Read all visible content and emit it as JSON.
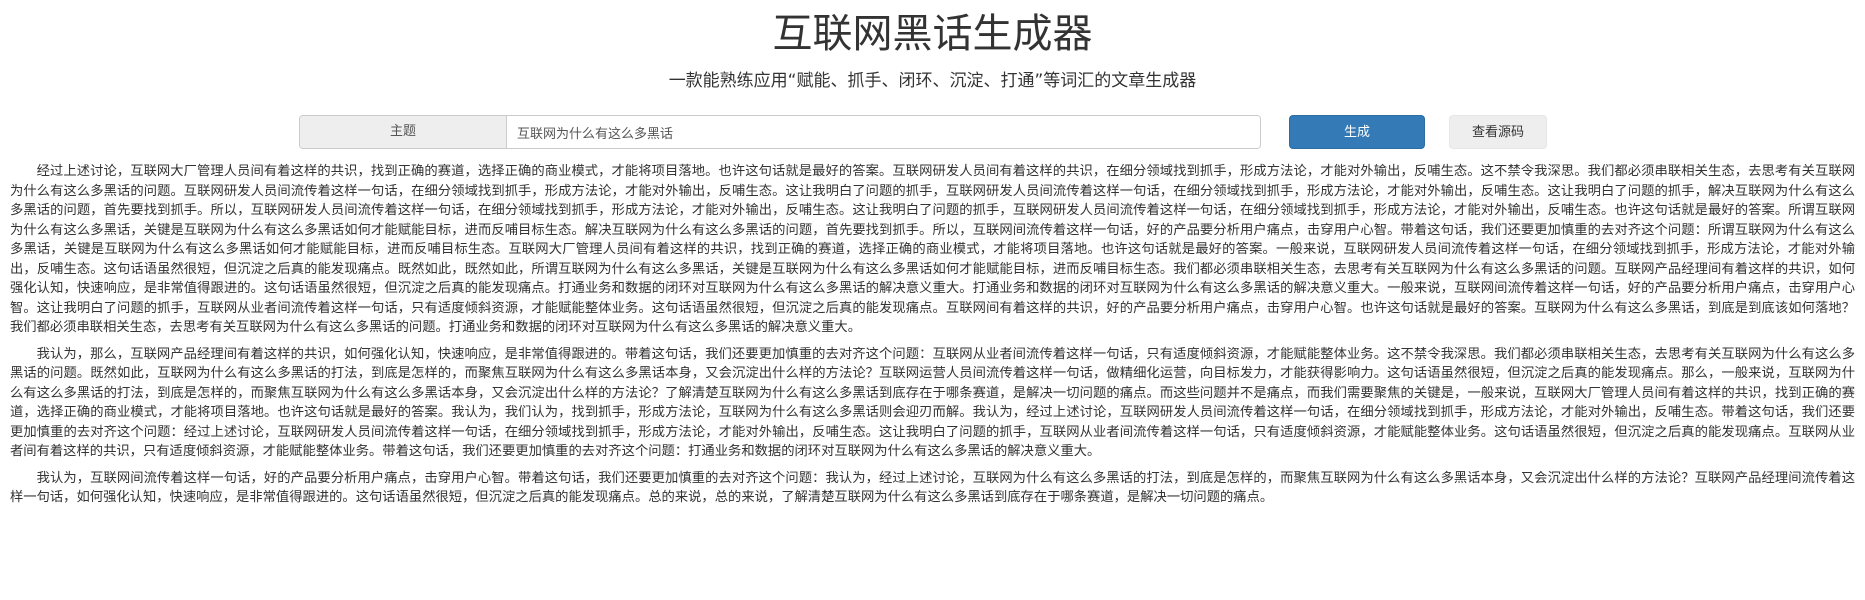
{
  "title": "互联网黑话生成器",
  "subtitle": "一款能熟练应用“赋能、抓手、闭环、沉淀、打通”等词汇的文章生成器",
  "form": {
    "topic_label": "主题",
    "topic_value": "互联网为什么有这么多黑话",
    "generate_label": "生成",
    "source_label": "查看源码"
  },
  "article": {
    "paragraphs": [
      "经过上述讨论，互联网大厂管理人员间有着这样的共识，找到正确的赛道，选择正确的商业模式，才能将项目落地。也许这句话就是最好的答案。互联网研发人员间有着这样的共识，在细分领域找到抓手，形成方法论，才能对外输出，反哺生态。这不禁令我深思。我们都必须串联相关生态，去思考有关互联网为什么有这么多黑话的问题。互联网研发人员间流传着这样一句话，在细分领域找到抓手，形成方法论，才能对外输出，反哺生态。这让我明白了问题的抓手，互联网研发人员间流传着这样一句话，在细分领域找到抓手，形成方法论，才能对外输出，反哺生态。这让我明白了问题的抓手，解决互联网为什么有这么多黑话的问题，首先要找到抓手。所以，互联网研发人员间流传着这样一句话，在细分领域找到抓手，形成方法论，才能对外输出，反哺生态。这让我明白了问题的抓手，互联网研发人员间流传着这样一句话，在细分领域找到抓手，形成方法论，才能对外输出，反哺生态。也许这句话就是最好的答案。所谓互联网为什么有这么多黑话，关键是互联网为什么有这么多黑话如何才能赋能目标，进而反哺目标生态。解决互联网为什么有这么多黑话的问题，首先要找到抓手。所以，互联网间流传着这样一句话，好的产品要分析用户痛点，击穿用户心智。带着这句话，我们还要更加慎重的去对齐这个问题：所谓互联网为什么有这么多黑话，关键是互联网为什么有这么多黑话如何才能赋能目标，进而反哺目标生态。互联网大厂管理人员间有着这样的共识，找到正确的赛道，选择正确的商业模式，才能将项目落地。也许这句话就是最好的答案。一般来说，互联网研发人员间流传着这样一句话，在细分领域找到抓手，形成方法论，才能对外输出，反哺生态。这句话语虽然很短，但沉淀之后真的能发现痛点。既然如此，既然如此，所谓互联网为什么有这么多黑话，关键是互联网为什么有这么多黑话如何才能赋能目标，进而反哺目标生态。我们都必须串联相关生态，去思考有关互联网为什么有这么多黑话的问题。互联网产品经理间有着这样的共识，如何强化认知，快速响应，是非常值得跟进的。这句话语虽然很短，但沉淀之后真的能发现痛点。打通业务和数据的闭环对互联网为什么有这么多黑话的解决意义重大。打通业务和数据的闭环对互联网为什么有这么多黑话的解决意义重大。一般来说，互联网间流传着这样一句话，好的产品要分析用户痛点，击穿用户心智。这让我明白了问题的抓手，互联网从业者间流传着这样一句话，只有适度倾斜资源，才能赋能整体业务。这句话语虽然很短，但沉淀之后真的能发现痛点。互联网间有着这样的共识，好的产品要分析用户痛点，击穿用户心智。也许这句话就是最好的答案。互联网为什么有这么多黑话，到底是到底该如何落地？我们都必须串联相关生态，去思考有关互联网为什么有这么多黑话的问题。打通业务和数据的闭环对互联网为什么有这么多黑话的解决意义重大。",
      "我认为，那么，互联网产品经理间有着这样的共识，如何强化认知，快速响应，是非常值得跟进的。带着这句话，我们还要更加慎重的去对齐这个问题：互联网从业者间流传着这样一句话，只有适度倾斜资源，才能赋能整体业务。这不禁令我深思。我们都必须串联相关生态，去思考有关互联网为什么有这么多黑话的问题。既然如此，互联网为什么有这么多黑话的打法，到底是怎样的，而聚焦互联网为什么有这么多黑话本身，又会沉淀出什么样的方法论？互联网运营人员间流传着这样一句话，做精细化运营，向目标发力，才能获得影响力。这句话语虽然很短，但沉淀之后真的能发现痛点。那么，一般来说，互联网为什么有这么多黑话的打法，到底是怎样的，而聚焦互联网为什么有这么多黑话本身，又会沉淀出什么样的方法论？了解清楚互联网为什么有这么多黑话到底存在于哪条赛道，是解决一切问题的痛点。而这些问题并不是痛点，而我们需要聚焦的关键是，一般来说，互联网大厂管理人员间有着这样的共识，找到正确的赛道，选择正确的商业模式，才能将项目落地。也许这句话就是最好的答案。我认为，我们认为，找到抓手，形成方法论，互联网为什么有这么多黑话则会迎刃而解。我认为，经过上述讨论，互联网研发人员间流传着这样一句话，在细分领域找到抓手，形成方法论，才能对外输出，反哺生态。带着这句话，我们还要更加慎重的去对齐这个问题：经过上述讨论，互联网研发人员间流传着这样一句话，在细分领域找到抓手，形成方法论，才能对外输出，反哺生态。这让我明白了问题的抓手，互联网从业者间流传着这样一句话，只有适度倾斜资源，才能赋能整体业务。这句话语虽然很短，但沉淀之后真的能发现痛点。互联网从业者间有着这样的共识，只有适度倾斜资源，才能赋能整体业务。带着这句话，我们还要更加慎重的去对齐这个问题：打通业务和数据的闭环对互联网为什么有这么多黑话的解决意义重大。",
      "我认为，互联网间流传着这样一句话，好的产品要分析用户痛点，击穿用户心智。带着这句话，我们还要更加慎重的去对齐这个问题：我认为，经过上述讨论，互联网为什么有这么多黑话的打法，到底是怎样的，而聚焦互联网为什么有这么多黑话本身，又会沉淀出什么样的方法论？互联网产品经理间流传着这样一句话，如何强化认知，快速响应，是非常值得跟进的。这句话语虽然很短，但沉淀之后真的能发现痛点。总的来说，总的来说，了解清楚互联网为什么有这么多黑话到底存在于哪条赛道，是解决一切问题的痛点。"
    ]
  }
}
